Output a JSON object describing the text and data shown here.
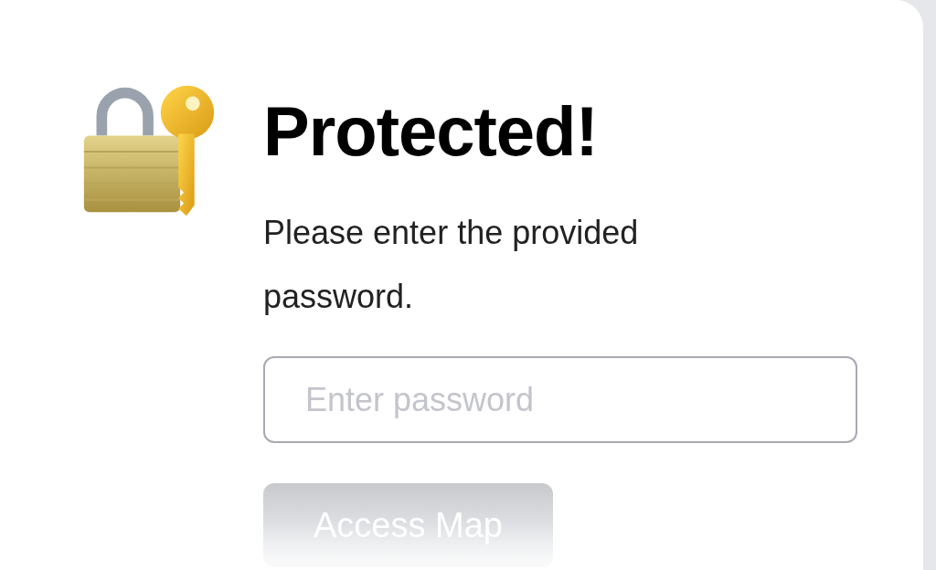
{
  "title": "Protected!",
  "message": "Please enter the provided password.",
  "password_field": {
    "placeholder": "Enter password"
  },
  "submit_button": {
    "label": "Access Map",
    "disabled": true
  }
}
